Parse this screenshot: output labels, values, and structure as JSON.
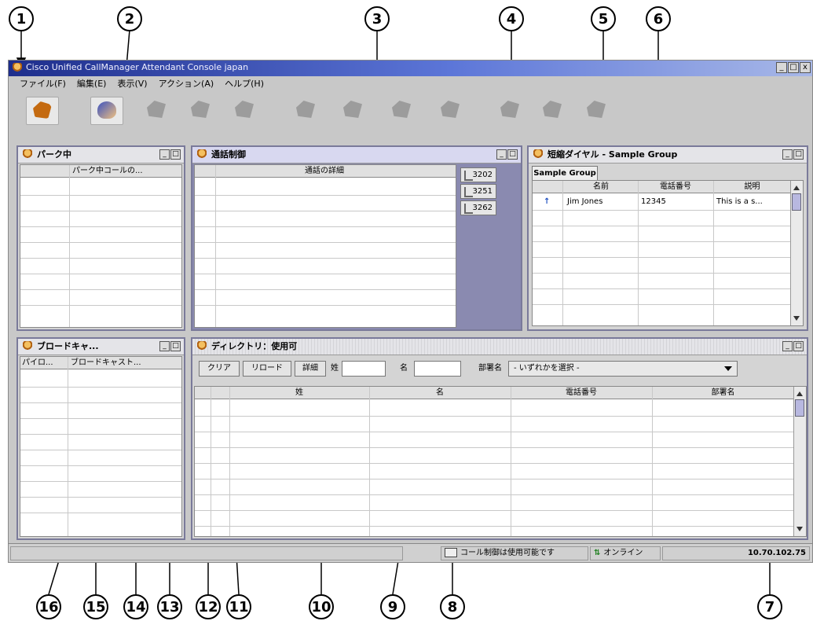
{
  "window": {
    "title": "Cisco Unified CallManager Attendant Console japan",
    "minimize": "_",
    "maximize": "□",
    "close": "x"
  },
  "menu": [
    "ファイル(F)",
    "編集(E)",
    "表示(V)",
    "アクション(A)",
    "ヘルプ(H)"
  ],
  "toolbar": {
    "icons": [
      "login-icon",
      "pickup-icon",
      "hold-icon",
      "park-icon",
      "transfer-icon",
      "redirect-icon",
      "answer-icon",
      "drop-icon",
      "conference-icon",
      "call-forward-icon",
      "speed-dial-icon",
      "message-icon"
    ]
  },
  "parked_panel": {
    "title": "パーク中",
    "column": "パーク中コールの..."
  },
  "call_control_panel": {
    "title": "通話制御",
    "column": "通話の詳細",
    "lines": [
      "3202",
      "3251",
      "3262"
    ]
  },
  "speed_dial_panel": {
    "title": "短縮ダイヤル - Sample Group",
    "tab": "Sample Group",
    "columns": [
      "名前",
      "電話番号",
      "説明"
    ],
    "rows": [
      {
        "name": "Jim Jones",
        "number": "12345",
        "description": "This is a s..."
      }
    ]
  },
  "broadcast_panel": {
    "title": "ブロードキャ...",
    "columns": [
      "パイロ...",
      "ブロードキャスト..."
    ]
  },
  "directory_panel": {
    "title": "ディレクトリ：使用可",
    "clear": "クリア",
    "reload": "リロード",
    "details": "詳細",
    "last_name_label": "姓",
    "first_name_label": "名",
    "department_label": "部署名",
    "department_select": "- いずれかを選択 -",
    "columns": [
      "",
      "姓",
      "名",
      "電話番号",
      "部署名"
    ]
  },
  "status": {
    "call_control": "コール制御は使用可能です",
    "online": "オンライン",
    "server_ip": "10.70.102.75"
  },
  "callouts": [
    "1",
    "2",
    "3",
    "4",
    "5",
    "6",
    "7",
    "8",
    "9",
    "10",
    "11",
    "12",
    "13",
    "14",
    "15",
    "16"
  ],
  "colors": {
    "titlebar_start": "#1e2e8c",
    "titlebar_end": "#a8b8e8",
    "panel_border": "#7a7a9a",
    "call_control_bg": "#8a8ab0"
  }
}
